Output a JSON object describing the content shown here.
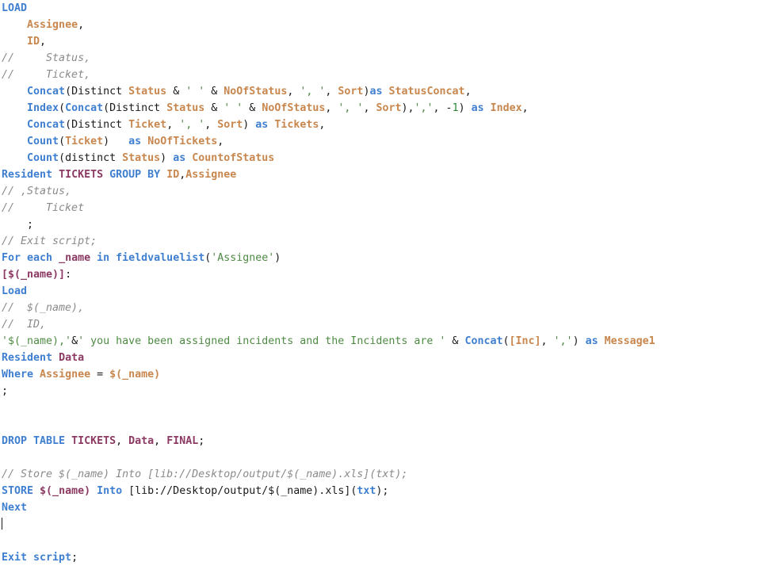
{
  "editor": {
    "language": "qlik-load-script",
    "background_color": "#ffffff",
    "colors": {
      "keyword": "#3f7fd0",
      "field": "#c8874e",
      "comment": "#8a8a8a",
      "string": "#4f8a44",
      "number": "#2e8b3d",
      "table": "#8c3a63",
      "variable": "#8c3a63",
      "plain": "#1a1a1a"
    },
    "cursor": {
      "line": 33,
      "column": 1,
      "visible": true
    },
    "lines": [
      {
        "n": 1,
        "tokens": [
          {
            "t": "LOAD",
            "c": "kw"
          }
        ]
      },
      {
        "n": 2,
        "tokens": [
          {
            "t": "    ",
            "c": "pln"
          },
          {
            "t": "Assignee",
            "c": "fld"
          },
          {
            "t": ",",
            "c": "pln"
          }
        ]
      },
      {
        "n": 3,
        "tokens": [
          {
            "t": "    ",
            "c": "pln"
          },
          {
            "t": "ID",
            "c": "fld"
          },
          {
            "t": ",",
            "c": "pln"
          }
        ]
      },
      {
        "n": 4,
        "tokens": [
          {
            "t": "//     Status,",
            "c": "cmt"
          }
        ]
      },
      {
        "n": 5,
        "tokens": [
          {
            "t": "//     Ticket,",
            "c": "cmt"
          }
        ]
      },
      {
        "n": 6,
        "tokens": [
          {
            "t": "    ",
            "c": "pln"
          },
          {
            "t": "Concat",
            "c": "kw"
          },
          {
            "t": "(Distinct ",
            "c": "pln"
          },
          {
            "t": "Status",
            "c": "fld"
          },
          {
            "t": " & ",
            "c": "pln"
          },
          {
            "t": "' '",
            "c": "str"
          },
          {
            "t": " & ",
            "c": "pln"
          },
          {
            "t": "NoOfStatus",
            "c": "fld"
          },
          {
            "t": ", ",
            "c": "pln"
          },
          {
            "t": "', '",
            "c": "str"
          },
          {
            "t": ", ",
            "c": "pln"
          },
          {
            "t": "Sort",
            "c": "fld"
          },
          {
            "t": ")",
            "c": "pln"
          },
          {
            "t": "as",
            "c": "kw"
          },
          {
            "t": " ",
            "c": "pln"
          },
          {
            "t": "StatusConcat",
            "c": "fld"
          },
          {
            "t": ",",
            "c": "pln"
          }
        ]
      },
      {
        "n": 7,
        "tokens": [
          {
            "t": "    ",
            "c": "pln"
          },
          {
            "t": "Index",
            "c": "kw"
          },
          {
            "t": "(",
            "c": "pln"
          },
          {
            "t": "Concat",
            "c": "kw"
          },
          {
            "t": "(Distinct ",
            "c": "pln"
          },
          {
            "t": "Status",
            "c": "fld"
          },
          {
            "t": " & ",
            "c": "pln"
          },
          {
            "t": "' '",
            "c": "str"
          },
          {
            "t": " & ",
            "c": "pln"
          },
          {
            "t": "NoOfStatus",
            "c": "fld"
          },
          {
            "t": ", ",
            "c": "pln"
          },
          {
            "t": "', '",
            "c": "str"
          },
          {
            "t": ", ",
            "c": "pln"
          },
          {
            "t": "Sort",
            "c": "fld"
          },
          {
            "t": "),",
            "c": "pln"
          },
          {
            "t": "','",
            "c": "str"
          },
          {
            "t": ", -",
            "c": "pln"
          },
          {
            "t": "1",
            "c": "num"
          },
          {
            "t": ") ",
            "c": "pln"
          },
          {
            "t": "as",
            "c": "kw"
          },
          {
            "t": " ",
            "c": "pln"
          },
          {
            "t": "Index",
            "c": "fld"
          },
          {
            "t": ",",
            "c": "pln"
          }
        ]
      },
      {
        "n": 8,
        "tokens": [
          {
            "t": "    ",
            "c": "pln"
          },
          {
            "t": "Concat",
            "c": "kw"
          },
          {
            "t": "(Distinct ",
            "c": "pln"
          },
          {
            "t": "Ticket",
            "c": "fld"
          },
          {
            "t": ", ",
            "c": "pln"
          },
          {
            "t": "', '",
            "c": "str"
          },
          {
            "t": ", ",
            "c": "pln"
          },
          {
            "t": "Sort",
            "c": "fld"
          },
          {
            "t": ") ",
            "c": "pln"
          },
          {
            "t": "as",
            "c": "kw"
          },
          {
            "t": " ",
            "c": "pln"
          },
          {
            "t": "Tickets",
            "c": "fld"
          },
          {
            "t": ",",
            "c": "pln"
          }
        ]
      },
      {
        "n": 9,
        "tokens": [
          {
            "t": "    ",
            "c": "pln"
          },
          {
            "t": "Count",
            "c": "kw"
          },
          {
            "t": "(",
            "c": "pln"
          },
          {
            "t": "Ticket",
            "c": "fld"
          },
          {
            "t": ")   ",
            "c": "pln"
          },
          {
            "t": "as",
            "c": "kw"
          },
          {
            "t": " ",
            "c": "pln"
          },
          {
            "t": "NoOfTickets",
            "c": "fld"
          },
          {
            "t": ",",
            "c": "pln"
          }
        ]
      },
      {
        "n": 10,
        "tokens": [
          {
            "t": "    ",
            "c": "pln"
          },
          {
            "t": "Count",
            "c": "kw"
          },
          {
            "t": "(distinct ",
            "c": "pln"
          },
          {
            "t": "Status",
            "c": "fld"
          },
          {
            "t": ") ",
            "c": "pln"
          },
          {
            "t": "as",
            "c": "kw"
          },
          {
            "t": " ",
            "c": "pln"
          },
          {
            "t": "CountofStatus",
            "c": "fld"
          }
        ]
      },
      {
        "n": 11,
        "tokens": [
          {
            "t": "Resident",
            "c": "kw"
          },
          {
            "t": " ",
            "c": "pln"
          },
          {
            "t": "TICKETS",
            "c": "tbl"
          },
          {
            "t": " ",
            "c": "pln"
          },
          {
            "t": "GROUP BY",
            "c": "kw"
          },
          {
            "t": " ",
            "c": "pln"
          },
          {
            "t": "ID",
            "c": "fld"
          },
          {
            "t": ",",
            "c": "pln"
          },
          {
            "t": "Assignee",
            "c": "fld"
          }
        ]
      },
      {
        "n": 12,
        "tokens": [
          {
            "t": "// ,Status,",
            "c": "cmt"
          }
        ]
      },
      {
        "n": 13,
        "tokens": [
          {
            "t": "//     Ticket",
            "c": "cmt"
          }
        ]
      },
      {
        "n": 14,
        "tokens": [
          {
            "t": "    ;",
            "c": "pln"
          }
        ]
      },
      {
        "n": 15,
        "tokens": [
          {
            "t": "// Exit script;",
            "c": "cmt"
          }
        ]
      },
      {
        "n": 16,
        "tokens": [
          {
            "t": "For each",
            "c": "kw"
          },
          {
            "t": " ",
            "c": "pln"
          },
          {
            "t": "_name",
            "c": "var"
          },
          {
            "t": " ",
            "c": "pln"
          },
          {
            "t": "in",
            "c": "kw"
          },
          {
            "t": " ",
            "c": "pln"
          },
          {
            "t": "fieldvaluelist",
            "c": "kw"
          },
          {
            "t": "(",
            "c": "pln"
          },
          {
            "t": "'Assignee'",
            "c": "str"
          },
          {
            "t": ")",
            "c": "pln"
          }
        ]
      },
      {
        "n": 17,
        "tokens": [
          {
            "t": "[$(_name)]",
            "c": "lbl"
          },
          {
            "t": ":",
            "c": "pln"
          }
        ]
      },
      {
        "n": 18,
        "tokens": [
          {
            "t": "Load",
            "c": "kw"
          }
        ]
      },
      {
        "n": 19,
        "tokens": [
          {
            "t": "//  $(_name),",
            "c": "cmt"
          }
        ]
      },
      {
        "n": 20,
        "tokens": [
          {
            "t": "//  ID,",
            "c": "cmt"
          }
        ]
      },
      {
        "n": 21,
        "tokens": [
          {
            "t": "'$(_name),'",
            "c": "str"
          },
          {
            "t": "&",
            "c": "pln"
          },
          {
            "t": "' you have been assigned incidents and the Incidents are '",
            "c": "str"
          },
          {
            "t": " & ",
            "c": "pln"
          },
          {
            "t": "Concat",
            "c": "kw"
          },
          {
            "t": "(",
            "c": "pln"
          },
          {
            "t": "[Inc]",
            "c": "fld"
          },
          {
            "t": ", ",
            "c": "pln"
          },
          {
            "t": "','",
            "c": "str"
          },
          {
            "t": ") ",
            "c": "pln"
          },
          {
            "t": "as",
            "c": "kw"
          },
          {
            "t": " ",
            "c": "pln"
          },
          {
            "t": "Message1",
            "c": "fld"
          }
        ]
      },
      {
        "n": 22,
        "tokens": [
          {
            "t": "Resident",
            "c": "kw"
          },
          {
            "t": " ",
            "c": "pln"
          },
          {
            "t": "Data",
            "c": "tbl"
          }
        ]
      },
      {
        "n": 23,
        "tokens": [
          {
            "t": "Where",
            "c": "kw"
          },
          {
            "t": " ",
            "c": "pln"
          },
          {
            "t": "Assignee",
            "c": "fld"
          },
          {
            "t": " = ",
            "c": "pln"
          },
          {
            "t": "$(_name)",
            "c": "fld"
          }
        ]
      },
      {
        "n": 24,
        "tokens": [
          {
            "t": ";",
            "c": "pln"
          }
        ]
      },
      {
        "n": 25,
        "tokens": []
      },
      {
        "n": 26,
        "tokens": []
      },
      {
        "n": 27,
        "tokens": [
          {
            "t": "DROP TABLE",
            "c": "kw"
          },
          {
            "t": " ",
            "c": "pln"
          },
          {
            "t": "TICKETS",
            "c": "tbl"
          },
          {
            "t": ", ",
            "c": "pln"
          },
          {
            "t": "Data",
            "c": "tbl"
          },
          {
            "t": ", ",
            "c": "pln"
          },
          {
            "t": "FINAL",
            "c": "tbl"
          },
          {
            "t": ";",
            "c": "pln"
          }
        ]
      },
      {
        "n": 28,
        "tokens": []
      },
      {
        "n": 29,
        "tokens": [
          {
            "t": "// Store $(_name) Into [lib://Desktop/output/$(_name).xls](txt);",
            "c": "cmt"
          }
        ]
      },
      {
        "n": 30,
        "tokens": [
          {
            "t": "STORE",
            "c": "kw"
          },
          {
            "t": " ",
            "c": "pln"
          },
          {
            "t": "$(_name)",
            "c": "var"
          },
          {
            "t": " ",
            "c": "pln"
          },
          {
            "t": "Into",
            "c": "kw"
          },
          {
            "t": " [lib://Desktop/output/$(_name).xls](",
            "c": "pln"
          },
          {
            "t": "txt",
            "c": "kw"
          },
          {
            "t": ");",
            "c": "pln"
          }
        ]
      },
      {
        "n": 31,
        "tokens": [
          {
            "t": "Next",
            "c": "kw"
          }
        ]
      },
      {
        "n": 32,
        "tokens": [],
        "caret": true
      },
      {
        "n": 33,
        "tokens": []
      },
      {
        "n": 34,
        "tokens": [
          {
            "t": "Exit script",
            "c": "kw"
          },
          {
            "t": ";",
            "c": "pln"
          }
        ]
      }
    ]
  }
}
